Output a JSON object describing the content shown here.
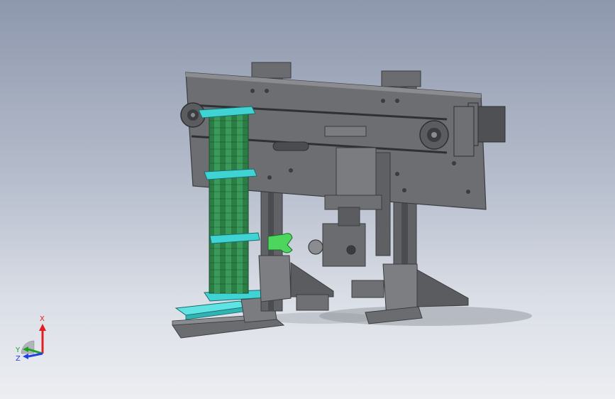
{
  "triad": {
    "x_label": "X",
    "y_label": "Y",
    "z_label": "Z",
    "colors": {
      "x": "#e02020",
      "y": "#20a020",
      "z": "#2040e0"
    }
  },
  "scene": {
    "background_top": "#8e98ad",
    "background_bottom": "#eceef2",
    "part_colors": {
      "frame": "#6c6e72",
      "frame_dark": "#4a4c50",
      "frame_light": "#8a8c90",
      "highlight_cyan": "#3fd3d3",
      "highlight_green": "#3bd15a",
      "spring_green": "#2e8a4a"
    }
  }
}
